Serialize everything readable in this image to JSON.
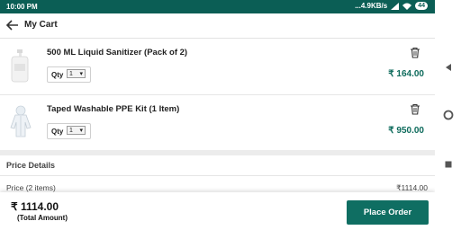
{
  "status_bar": {
    "time": "10:00 PM",
    "network_speed": "...4.9KB/s",
    "battery": "44"
  },
  "app_bar": {
    "title": "My Cart",
    "back_icon": "arrow-left-icon"
  },
  "cart": {
    "items": [
      {
        "name": "500 ML Liquid Sanitizer (Pack of 2)",
        "qty_label": "Qty",
        "qty_value": "1",
        "price": "₹ 164.00",
        "image": "sanitizer-bottle-image"
      },
      {
        "name": "Taped Washable PPE Kit (1 Item)",
        "qty_label": "Qty",
        "qty_value": "1",
        "price": "₹ 950.00",
        "image": "ppe-kit-image"
      }
    ]
  },
  "price_details": {
    "title": "Price Details",
    "rows": [
      {
        "label": "Price (2 items)",
        "value": "₹1114.00"
      }
    ]
  },
  "footer": {
    "total_amount": "₹ 1114.00",
    "total_label": "(Total Amount)",
    "place_order_label": "Place Order"
  },
  "colors": {
    "status_bar": "#0b5e55",
    "accent": "#0f6e62",
    "price_text": "#0e6b5c"
  }
}
